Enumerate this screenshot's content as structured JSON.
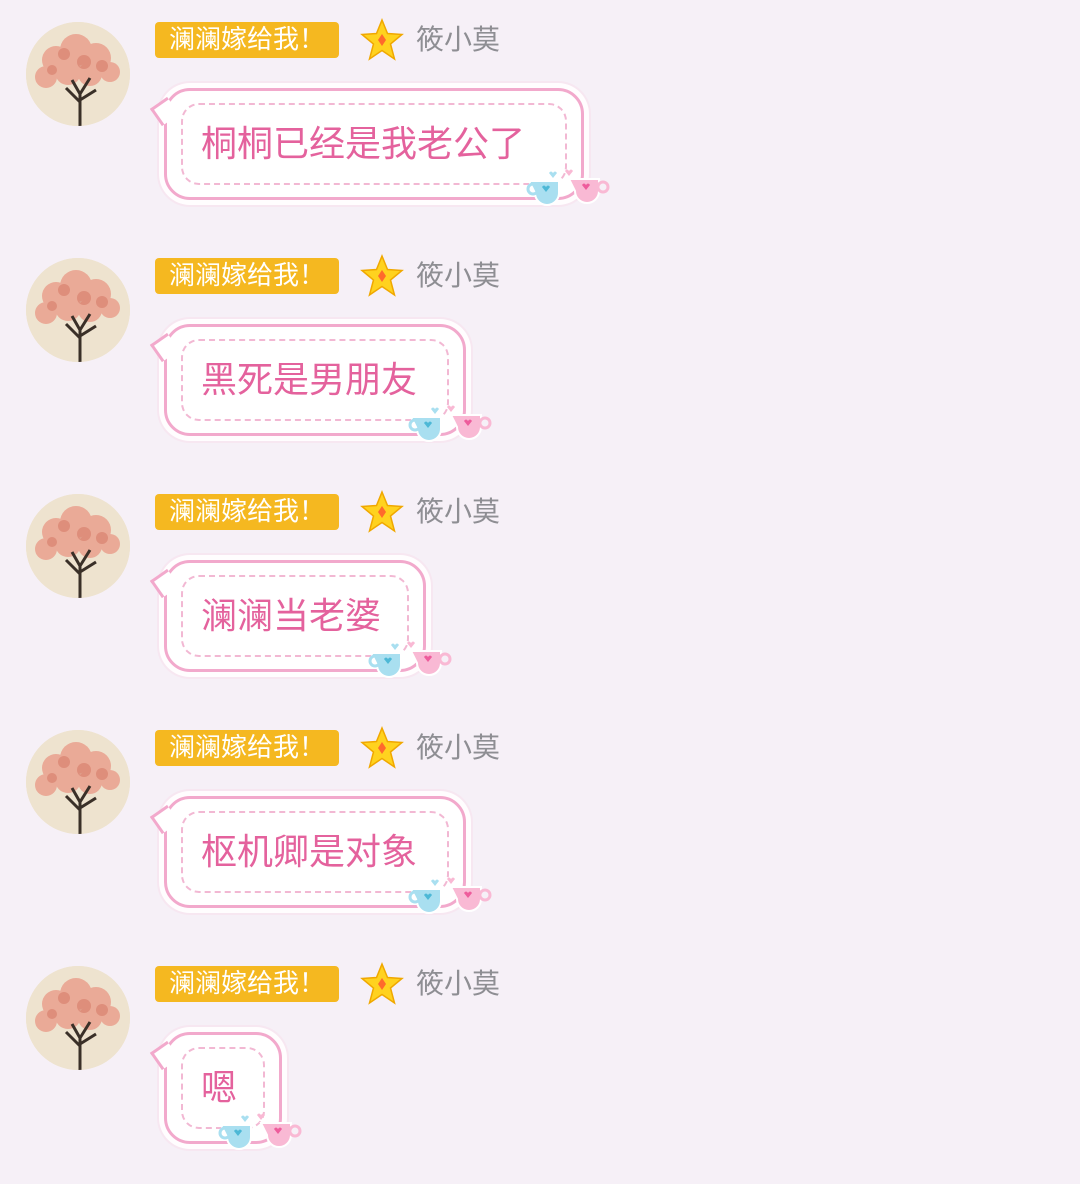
{
  "messages": [
    {
      "sender": {
        "title_badge": "澜澜嫁给我！",
        "badge_icon": "star-icon",
        "nickname": "筱小莫",
        "avatar": "avatar-tree"
      },
      "text": "桐桐已经是我老公了"
    },
    {
      "sender": {
        "title_badge": "澜澜嫁给我！",
        "badge_icon": "star-icon",
        "nickname": "筱小莫",
        "avatar": "avatar-tree"
      },
      "text": "黑死是男朋友"
    },
    {
      "sender": {
        "title_badge": "澜澜嫁给我！",
        "badge_icon": "star-icon",
        "nickname": "筱小莫",
        "avatar": "avatar-tree"
      },
      "text": "澜澜当老婆"
    },
    {
      "sender": {
        "title_badge": "澜澜嫁给我！",
        "badge_icon": "star-icon",
        "nickname": "筱小莫",
        "avatar": "avatar-tree"
      },
      "text": "枢机卿是对象"
    },
    {
      "sender": {
        "title_badge": "澜澜嫁给我！",
        "badge_icon": "star-icon",
        "nickname": "筱小莫",
        "avatar": "avatar-tree"
      },
      "text": "嗯"
    }
  ],
  "colors": {
    "background": "#f6f0f7",
    "badge": "#f5b820",
    "bubble_border": "#f2a9cc",
    "bubble_text": "#e4629d",
    "nickname": "#8e8e93"
  }
}
